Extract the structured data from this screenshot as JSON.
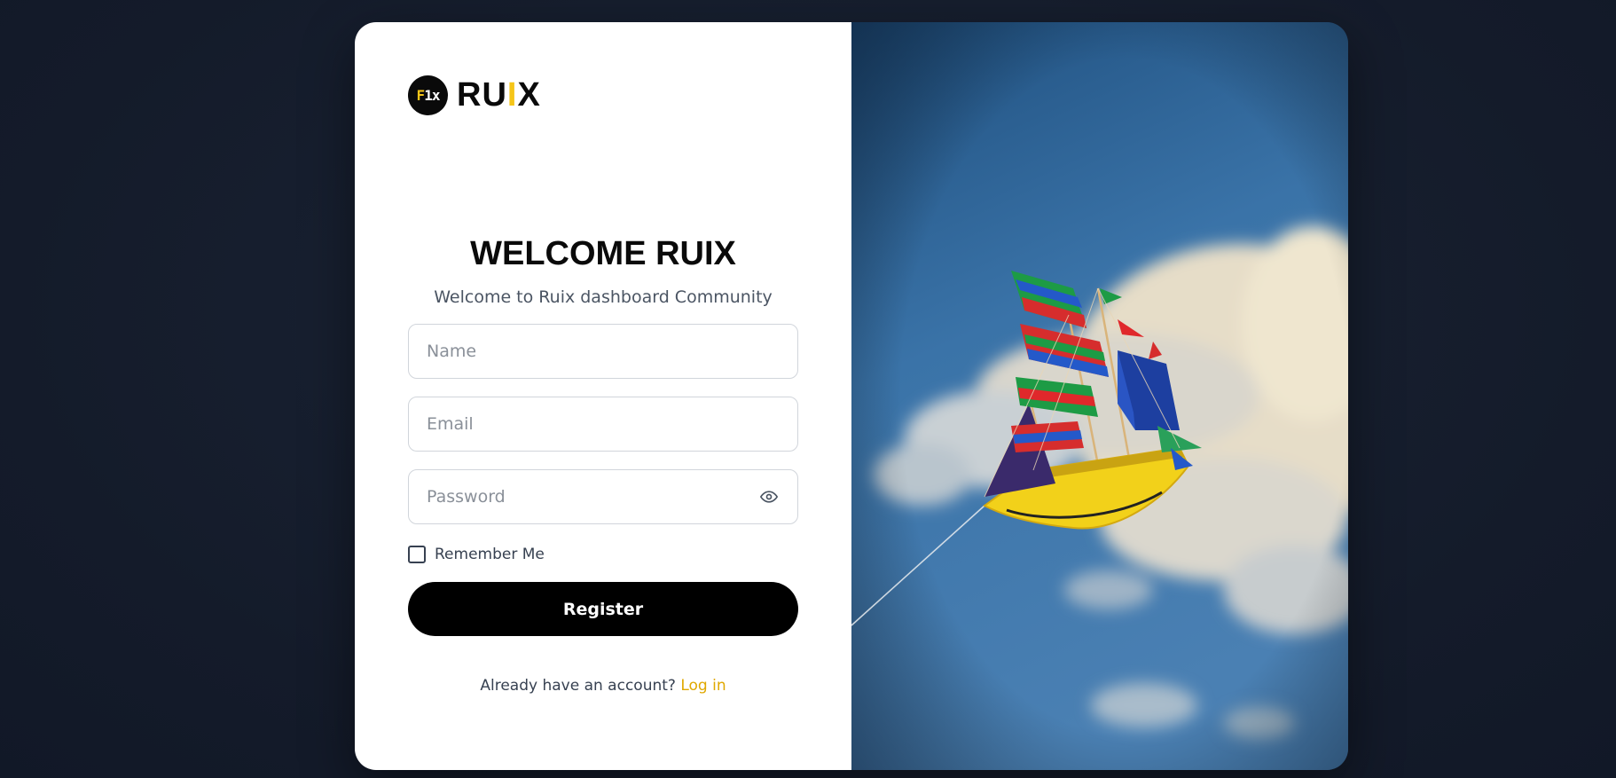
{
  "brand": {
    "badge": {
      "part1": "F",
      "part2": "1x"
    },
    "name": {
      "prefix": "RU",
      "accent": "I",
      "suffix": "X"
    },
    "accent_color": "#f5c518"
  },
  "welcome": {
    "title": "WELCOME RUIX",
    "subtitle": "Welcome to Ruix dashboard Community"
  },
  "form": {
    "name_placeholder": "Name",
    "email_placeholder": "Email",
    "password_placeholder": "Password",
    "password_toggle_icon": "eye-icon",
    "remember_label": "Remember Me",
    "remember_checked": false,
    "register_label": "Register"
  },
  "footer": {
    "prompt": "Already have an account?",
    "login_link": "Log in",
    "link_color": "#e0a800"
  },
  "hero_image": {
    "subject": "ship-kite"
  }
}
